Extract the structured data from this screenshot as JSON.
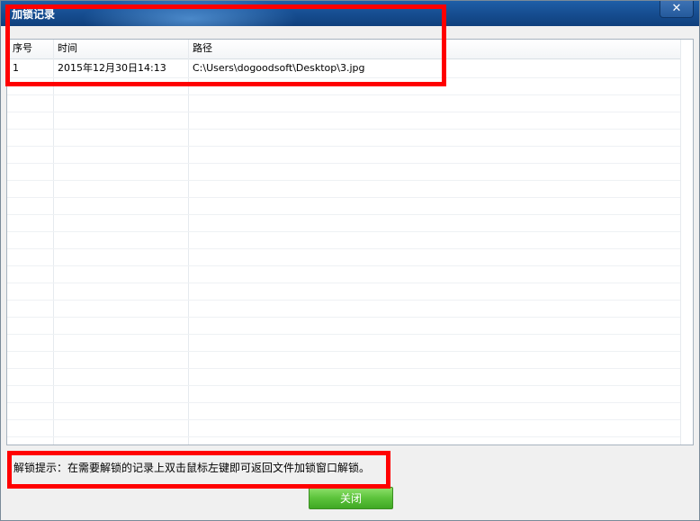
{
  "window": {
    "title": "加锁记录",
    "close_glyph": "✕"
  },
  "table": {
    "columns": [
      "序号",
      "时间",
      "路径"
    ],
    "rows": [
      [
        "1",
        "2015年12月30日14:13",
        "C:\\Users\\dogoodsoft\\Desktop\\3.jpg"
      ]
    ]
  },
  "hint": "解锁提示：在需要解锁的记录上双击鼠标左键即可返回文件加锁窗口解锁。",
  "buttons": {
    "close_label": "关闭"
  },
  "colors": {
    "highlight": "#ff0000",
    "button_green": "#5cc33b",
    "titlebar_blue": "#174f93"
  }
}
